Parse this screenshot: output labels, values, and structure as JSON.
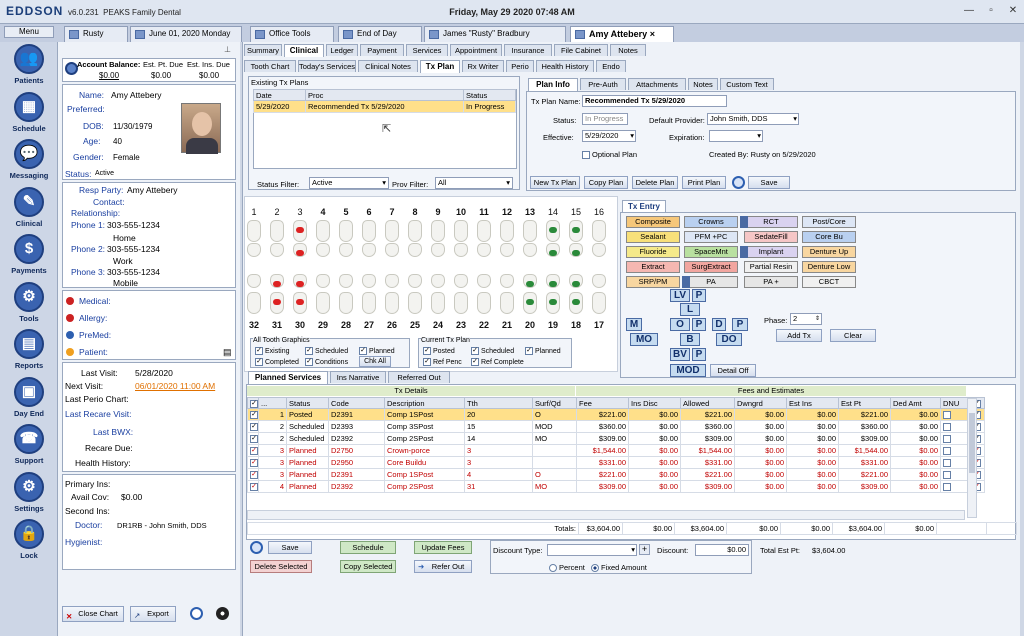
{
  "app": {
    "logo": "EDDSON",
    "version": "v6.0.231",
    "practice": "PEAKS Family Dental",
    "datetime": "Friday, May 29 2020 07:48 AM"
  },
  "patient_tabs": [
    {
      "label": "Rusty"
    },
    {
      "label": "June 01, 2020 Monday"
    },
    {
      "label": "Office Tools"
    },
    {
      "label": "End of Day"
    },
    {
      "label": "James \"Rusty\" Bradbury"
    },
    {
      "label": "Amy Attebery",
      "close": "×"
    }
  ],
  "nav": {
    "menu": "Menu",
    "items": [
      {
        "label": "Patients",
        "icon": "patients-icon",
        "glyph": "👥"
      },
      {
        "label": "Schedule",
        "icon": "schedule-icon",
        "glyph": "▦"
      },
      {
        "label": "Messaging",
        "icon": "messaging-icon",
        "glyph": "💬"
      },
      {
        "label": "Clinical",
        "icon": "clinical-icon",
        "glyph": "✎"
      },
      {
        "label": "Payments",
        "icon": "payments-icon",
        "glyph": "$"
      },
      {
        "label": "Tools",
        "icon": "tools-icon",
        "glyph": "⚙"
      },
      {
        "label": "Reports",
        "icon": "reports-icon",
        "glyph": "▤"
      },
      {
        "label": "Day End",
        "icon": "day-end-icon",
        "glyph": "▣"
      },
      {
        "label": "Support",
        "icon": "support-icon",
        "glyph": "☎"
      },
      {
        "label": "Settings",
        "icon": "settings-icon",
        "glyph": "⚙"
      },
      {
        "label": "Lock",
        "icon": "lock-icon",
        "glyph": "🔒"
      }
    ]
  },
  "left": {
    "balance": {
      "h1": "Account Balance:",
      "h2": "Est. Pt. Due",
      "h3": "Est. Ins. Due",
      "v1": "$0.00",
      "v2": "$0.00",
      "v3": "$0.00"
    },
    "name_lbl": "Name:",
    "name": "Amy Attebery",
    "preferred_lbl": "Preferred:",
    "dob_lbl": "DOB:",
    "dob": "11/30/1979",
    "age_lbl": "Age:",
    "age": "40",
    "gender_lbl": "Gender:",
    "gender": "Female",
    "status_lbl": "Status:",
    "status": "Active",
    "resp_lbl": "Resp Party:",
    "resp": "Amy Attebery",
    "contact_lbl": "Contact:",
    "relationship_lbl": "Relationship:",
    "phone1_lbl": "Phone 1:",
    "phone1": "303-555-1234",
    "phone2_lbl": "Phone 2:",
    "phone2": "303-555-1234",
    "phone2_type": "Home",
    "phone3_lbl": "Phone 3:",
    "phone3": "303-555-1234",
    "phone3_type": "Work",
    "phone_mobile": "Mobile",
    "medical": "Medical:",
    "allergy": "Allergy:",
    "premed": "PreMed:",
    "patient": "Patient:",
    "last_visit_lbl": "Last Visit:",
    "last_visit": "5/28/2020",
    "next_visit_lbl": "Next Visit:",
    "next_visit": "06/01/2020 11:00 AM",
    "last_perio_lbl": "Last Perio Chart:",
    "last_recare_lbl": "Last Recare Visit:",
    "last_bwx_lbl": "Last BWX:",
    "recare_due_lbl": "Recare Due:",
    "health_hist_lbl": "Health History:",
    "primary_ins_lbl": "Primary Ins:",
    "avail_cov_lbl": "Avail Cov:",
    "avail_cov": "$0.00",
    "second_ins_lbl": "Second Ins:",
    "doctor_lbl": "Doctor:",
    "doctor": "DR1RB - John Smith, DDS",
    "hygienist_lbl": "Hygienist:",
    "close_chart": "Close Chart",
    "export": "Export"
  },
  "top_tabs": [
    "Summary",
    "Clinical",
    "Ledger",
    "Payment",
    "Services",
    "Appointment",
    "Insurance",
    "File Cabinet",
    "Notes"
  ],
  "sub_tabs": [
    "Tooth Chart",
    "Today's Services",
    "Clinical Notes",
    "Tx Plan",
    "Rx Writer",
    "Perio",
    "Health History",
    "Endo"
  ],
  "tx_plans": {
    "title": "Existing Tx Plans",
    "cols": [
      "Date",
      "Proc",
      "Status"
    ],
    "rows": [
      {
        "date": "5/29/2020",
        "proc": "Recommended Tx 5/29/2020",
        "status": "In Progress"
      }
    ],
    "status_filter_lbl": "Status Filter:",
    "status_filter": "Active",
    "prov_filter_lbl": "Prov Filter:",
    "prov_filter": "All"
  },
  "plan_info": {
    "tabs": [
      "Plan Info",
      "Pre-Auth",
      "Attachments",
      "Notes",
      "Custom Text"
    ],
    "name_lbl": "Tx Plan Name:",
    "name": "Recommended Tx 5/29/2020",
    "status_lbl": "Status:",
    "status": "In Progress",
    "default_prov_lbl": "Default Provider:",
    "default_prov": "John Smith, DDS",
    "effective_lbl": "Effective:",
    "effective": "5/29/2020",
    "expiration_lbl": "Expiration:",
    "optional_lbl": "Optional Plan",
    "created_by": "Created By: Rusty on 5/29/2020",
    "buttons": [
      "New Tx Plan",
      "Copy Plan",
      "Delete Plan",
      "Print Plan"
    ],
    "save": "Save"
  },
  "teeth_upper": [
    "1",
    "2",
    "3",
    "4",
    "5",
    "6",
    "7",
    "8",
    "9",
    "10",
    "11",
    "12",
    "13",
    "14",
    "15",
    "16"
  ],
  "teeth_lower": [
    "32",
    "31",
    "30",
    "29",
    "28",
    "27",
    "26",
    "25",
    "24",
    "23",
    "22",
    "21",
    "20",
    "19",
    "18",
    "17"
  ],
  "all_tooth": {
    "title": "All Tooth Graphics",
    "items": [
      "Existing",
      "Scheduled",
      "Planned",
      "Completed",
      "Conditions"
    ],
    "chk_all": "Chk All"
  },
  "current_tx": {
    "title": "Current Tx Plan",
    "items": [
      "Posted",
      "Scheduled",
      "Planned",
      "Ref Penc",
      "Ref Complete"
    ]
  },
  "tx_entry": {
    "title": "Tx Entry",
    "buttons": [
      {
        "label": "Composite",
        "color": "#f6c77a"
      },
      {
        "label": "Crowns",
        "color": "#b9d0f0"
      },
      {
        "label": "RCT",
        "color": "#d9d2f0"
      },
      {
        "label": "Post/Core",
        "color": "#dde6f5"
      },
      {
        "label": "Sealant",
        "color": "#f8e07a"
      },
      {
        "label": "PFM +PC",
        "color": "#dde6f5"
      },
      {
        "label": "SedateFill",
        "color": "#f5c6c6"
      },
      {
        "label": "Core Bu",
        "color": "#b9d0f0"
      },
      {
        "label": "Fluoride",
        "color": "#f5e98a"
      },
      {
        "label": "SpaceMnt",
        "color": "#b9e0a0"
      },
      {
        "label": "Implant",
        "color": "#d9d2f0"
      },
      {
        "label": "Denture Up",
        "color": "#f8d6a0"
      },
      {
        "label": "Extract",
        "color": "#f5b7b1"
      },
      {
        "label": "SurgExtract",
        "color": "#f2a6a0"
      },
      {
        "label": "Partial Resin",
        "color": "#f0f0f0"
      },
      {
        "label": "Denture Low",
        "color": "#f8d6a0"
      },
      {
        "label": "SRP/PM",
        "color": "#f8d6a0"
      },
      {
        "label": "PA",
        "color": "#e6e6e6"
      },
      {
        "label": "PA +",
        "color": "#e6e6e6"
      },
      {
        "label": "CBCT",
        "color": "#f0f0f0"
      }
    ],
    "surfaces": [
      "LV",
      "P",
      "L",
      "M",
      "O",
      "P",
      "D",
      "P",
      "MO",
      "B",
      "DO",
      "BV",
      "P"
    ],
    "mod": "MOD",
    "detail": "Detail Off",
    "phase_lbl": "Phase:",
    "phase": "2",
    "add_tx": "Add Tx",
    "clear": "Clear"
  },
  "services": {
    "tabs": [
      "Planned Services",
      "Ins Narrative",
      "Referred Out"
    ],
    "grp1": "Tx Details",
    "grp2": "Fees and Estimates",
    "cols": [
      "...",
      "Status",
      "Code",
      "Description",
      "Tth",
      "Surf/Qd",
      "Fee",
      "Ins Disc",
      "Allowed",
      "Dwngrd",
      "Est Ins",
      "Est Pt",
      "Ded Amt",
      "DNU"
    ],
    "rows": [
      {
        "n": "1",
        "status": "Posted",
        "code": "D2391",
        "desc": "Comp 1SPost",
        "tth": "20",
        "surf": "O",
        "fee": "$221.00",
        "disc": "$0.00",
        "allowed": "$221.00",
        "dwn": "$0.00",
        "estins": "$0.00",
        "estpt": "$221.00",
        "ded": "$0.00",
        "red": false,
        "sel": true
      },
      {
        "n": "2",
        "status": "Scheduled",
        "code": "D2393",
        "desc": "Comp 3SPost",
        "tth": "15",
        "surf": "MOD",
        "fee": "$360.00",
        "disc": "$0.00",
        "allowed": "$360.00",
        "dwn": "$0.00",
        "estins": "$0.00",
        "estpt": "$360.00",
        "ded": "$0.00",
        "red": false,
        "sel": false
      },
      {
        "n": "2",
        "status": "Scheduled",
        "code": "D2392",
        "desc": "Comp 2SPost",
        "tth": "14",
        "surf": "MO",
        "fee": "$309.00",
        "disc": "$0.00",
        "allowed": "$309.00",
        "dwn": "$0.00",
        "estins": "$0.00",
        "estpt": "$309.00",
        "ded": "$0.00",
        "red": false,
        "sel": false
      },
      {
        "n": "3",
        "status": "Planned",
        "code": "D2750",
        "desc": "Crown-porce",
        "tth": "3",
        "surf": "",
        "fee": "$1,544.00",
        "disc": "$0.00",
        "allowed": "$1,544.00",
        "dwn": "$0.00",
        "estins": "$0.00",
        "estpt": "$1,544.00",
        "ded": "$0.00",
        "red": true,
        "sel": false
      },
      {
        "n": "3",
        "status": "Planned",
        "code": "D2950",
        "desc": "Core Buildu",
        "tth": "3",
        "surf": "",
        "fee": "$331.00",
        "disc": "$0.00",
        "allowed": "$331.00",
        "dwn": "$0.00",
        "estins": "$0.00",
        "estpt": "$331.00",
        "ded": "$0.00",
        "red": true,
        "sel": false
      },
      {
        "n": "3",
        "status": "Planned",
        "code": "D2391",
        "desc": "Comp 1SPost",
        "tth": "4",
        "surf": "O",
        "fee": "$221.00",
        "disc": "$0.00",
        "allowed": "$221.00",
        "dwn": "$0.00",
        "estins": "$0.00",
        "estpt": "$221.00",
        "ded": "$0.00",
        "red": true,
        "sel": false
      },
      {
        "n": "4",
        "status": "Planned",
        "code": "D2392",
        "desc": "Comp 2SPost",
        "tth": "31",
        "surf": "MO",
        "fee": "$309.00",
        "disc": "$0.00",
        "allowed": "$309.00",
        "dwn": "$0.00",
        "estins": "$0.00",
        "estpt": "$309.00",
        "ded": "$0.00",
        "red": true,
        "sel": false
      }
    ],
    "totals_lbl": "Totals:",
    "t_fee": "$3,604.00",
    "t_disc": "$0.00",
    "t_allowed": "$3,604.00",
    "t_dwn": "$0.00",
    "t_estins": "$0.00",
    "t_estpt": "$3,604.00",
    "t_ded": "$0.00",
    "save": "Save",
    "schedule": "Schedule",
    "update_fees": "Update Fees",
    "delete_selected": "Delete Selected",
    "copy_selected": "Copy Selected",
    "refer_out": "Refer Out",
    "discount_type_lbl": "Discount Type:",
    "discount_lbl": "Discount:",
    "discount": "$0.00",
    "percent": "Percent",
    "fixed": "Fixed Amount",
    "total_est_pt_lbl": "Total Est Pt:",
    "total_est_pt": "$3,604.00"
  }
}
